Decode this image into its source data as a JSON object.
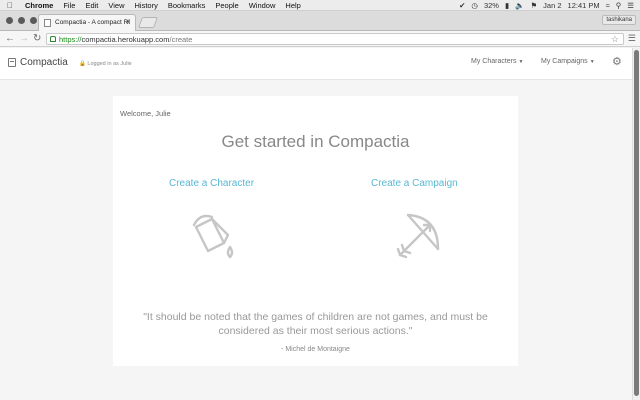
{
  "os_menubar": {
    "app_name": "Chrome",
    "menus": [
      "File",
      "Edit",
      "View",
      "History",
      "Bookmarks",
      "People",
      "Window",
      "Help"
    ],
    "battery": "32%",
    "date": "Jan 2",
    "time": "12:41 PM"
  },
  "browser": {
    "tab_title": "Compactia - A compact Ri",
    "profile_name": "tashikana",
    "url_scheme": "https://",
    "url_host": "compactia.herokuapp.com",
    "url_path": "/create"
  },
  "navbar": {
    "brand": "Compactia",
    "logged_in": "Logged in as Julie",
    "my_characters": "My Characters",
    "my_campaigns": "My Campaigns"
  },
  "main": {
    "welcome": "Welcome, Julie",
    "headline": "Get started in Compactia",
    "create_character": "Create a Character",
    "create_campaign": "Create a Campaign",
    "quote": "\"It should be noted that the games of children are not games, and must be considered as their most serious actions.\"",
    "author": "- Michel de Montaigne"
  },
  "colors": {
    "accent": "#56b7d4",
    "icon_gray": "#c6c6c6",
    "https_green": "#1b8a1b"
  }
}
